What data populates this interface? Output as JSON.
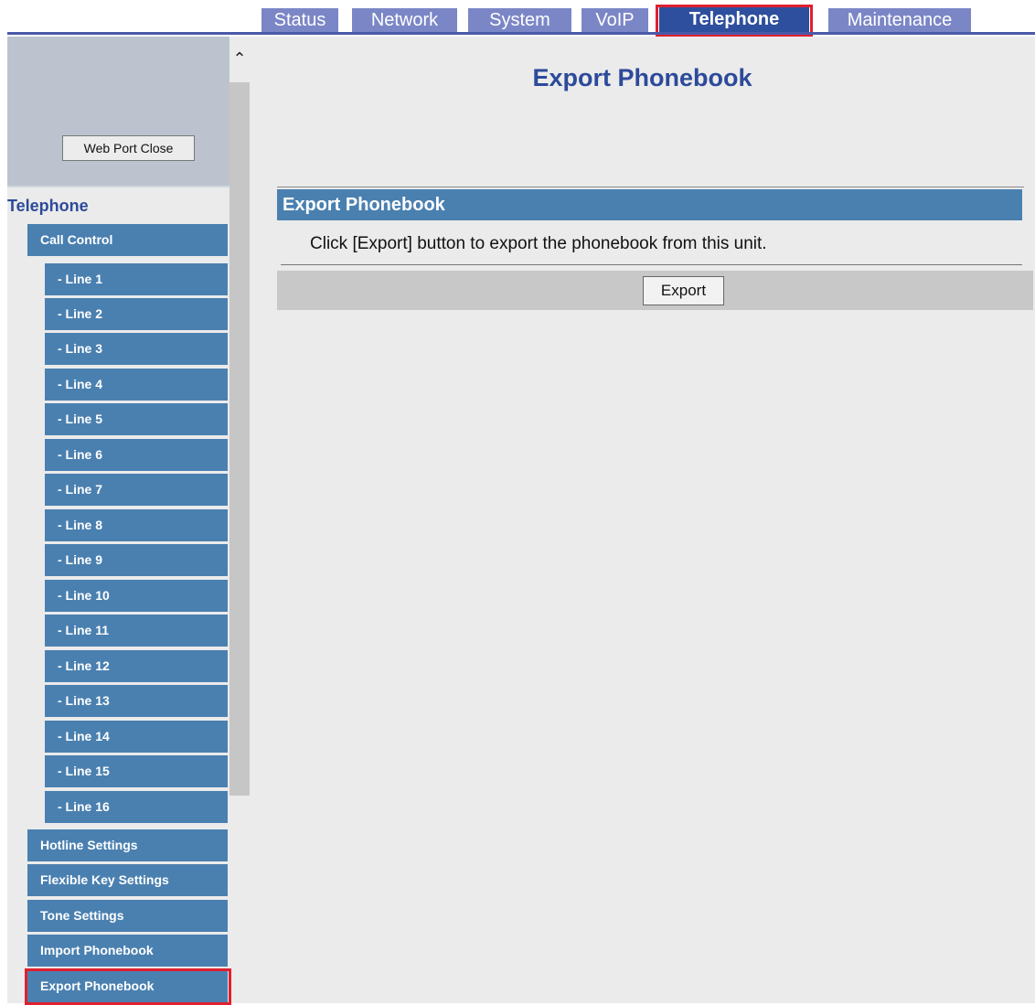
{
  "tabs": [
    {
      "label": "Status"
    },
    {
      "label": "Network"
    },
    {
      "label": "System"
    },
    {
      "label": "VoIP"
    },
    {
      "label": "Telephone",
      "active": true
    },
    {
      "label": "Maintenance"
    }
  ],
  "sidebar": {
    "web_port_button": "Web Port Close",
    "section_title": "Telephone",
    "items": [
      {
        "label": "Call Control"
      },
      {
        "label": "- Line 1"
      },
      {
        "label": "- Line 2"
      },
      {
        "label": "- Line 3"
      },
      {
        "label": "- Line 4"
      },
      {
        "label": "- Line 5"
      },
      {
        "label": "- Line 6"
      },
      {
        "label": "- Line 7"
      },
      {
        "label": "- Line 8"
      },
      {
        "label": "- Line 9"
      },
      {
        "label": "- Line 10"
      },
      {
        "label": "- Line 11"
      },
      {
        "label": "- Line 12"
      },
      {
        "label": "- Line 13"
      },
      {
        "label": "- Line 14"
      },
      {
        "label": "- Line 15"
      },
      {
        "label": "- Line 16"
      },
      {
        "label": "Hotline Settings"
      },
      {
        "label": "Flexible Key Settings"
      },
      {
        "label": "Tone Settings"
      },
      {
        "label": "Import Phonebook"
      },
      {
        "label": "Export Phonebook",
        "selected": true
      }
    ]
  },
  "main": {
    "page_title": "Export Phonebook",
    "section_header": "Export Phonebook",
    "description": "Click [Export] button to export the phonebook from this unit.",
    "export_button": "Export"
  },
  "colors": {
    "tab_bg": "#7b86c6",
    "tab_active_bg": "#2e4f9e",
    "nav_item_bg": "#4a80b0",
    "title_color": "#2d4a9a",
    "highlight_border": "#e0202e"
  }
}
